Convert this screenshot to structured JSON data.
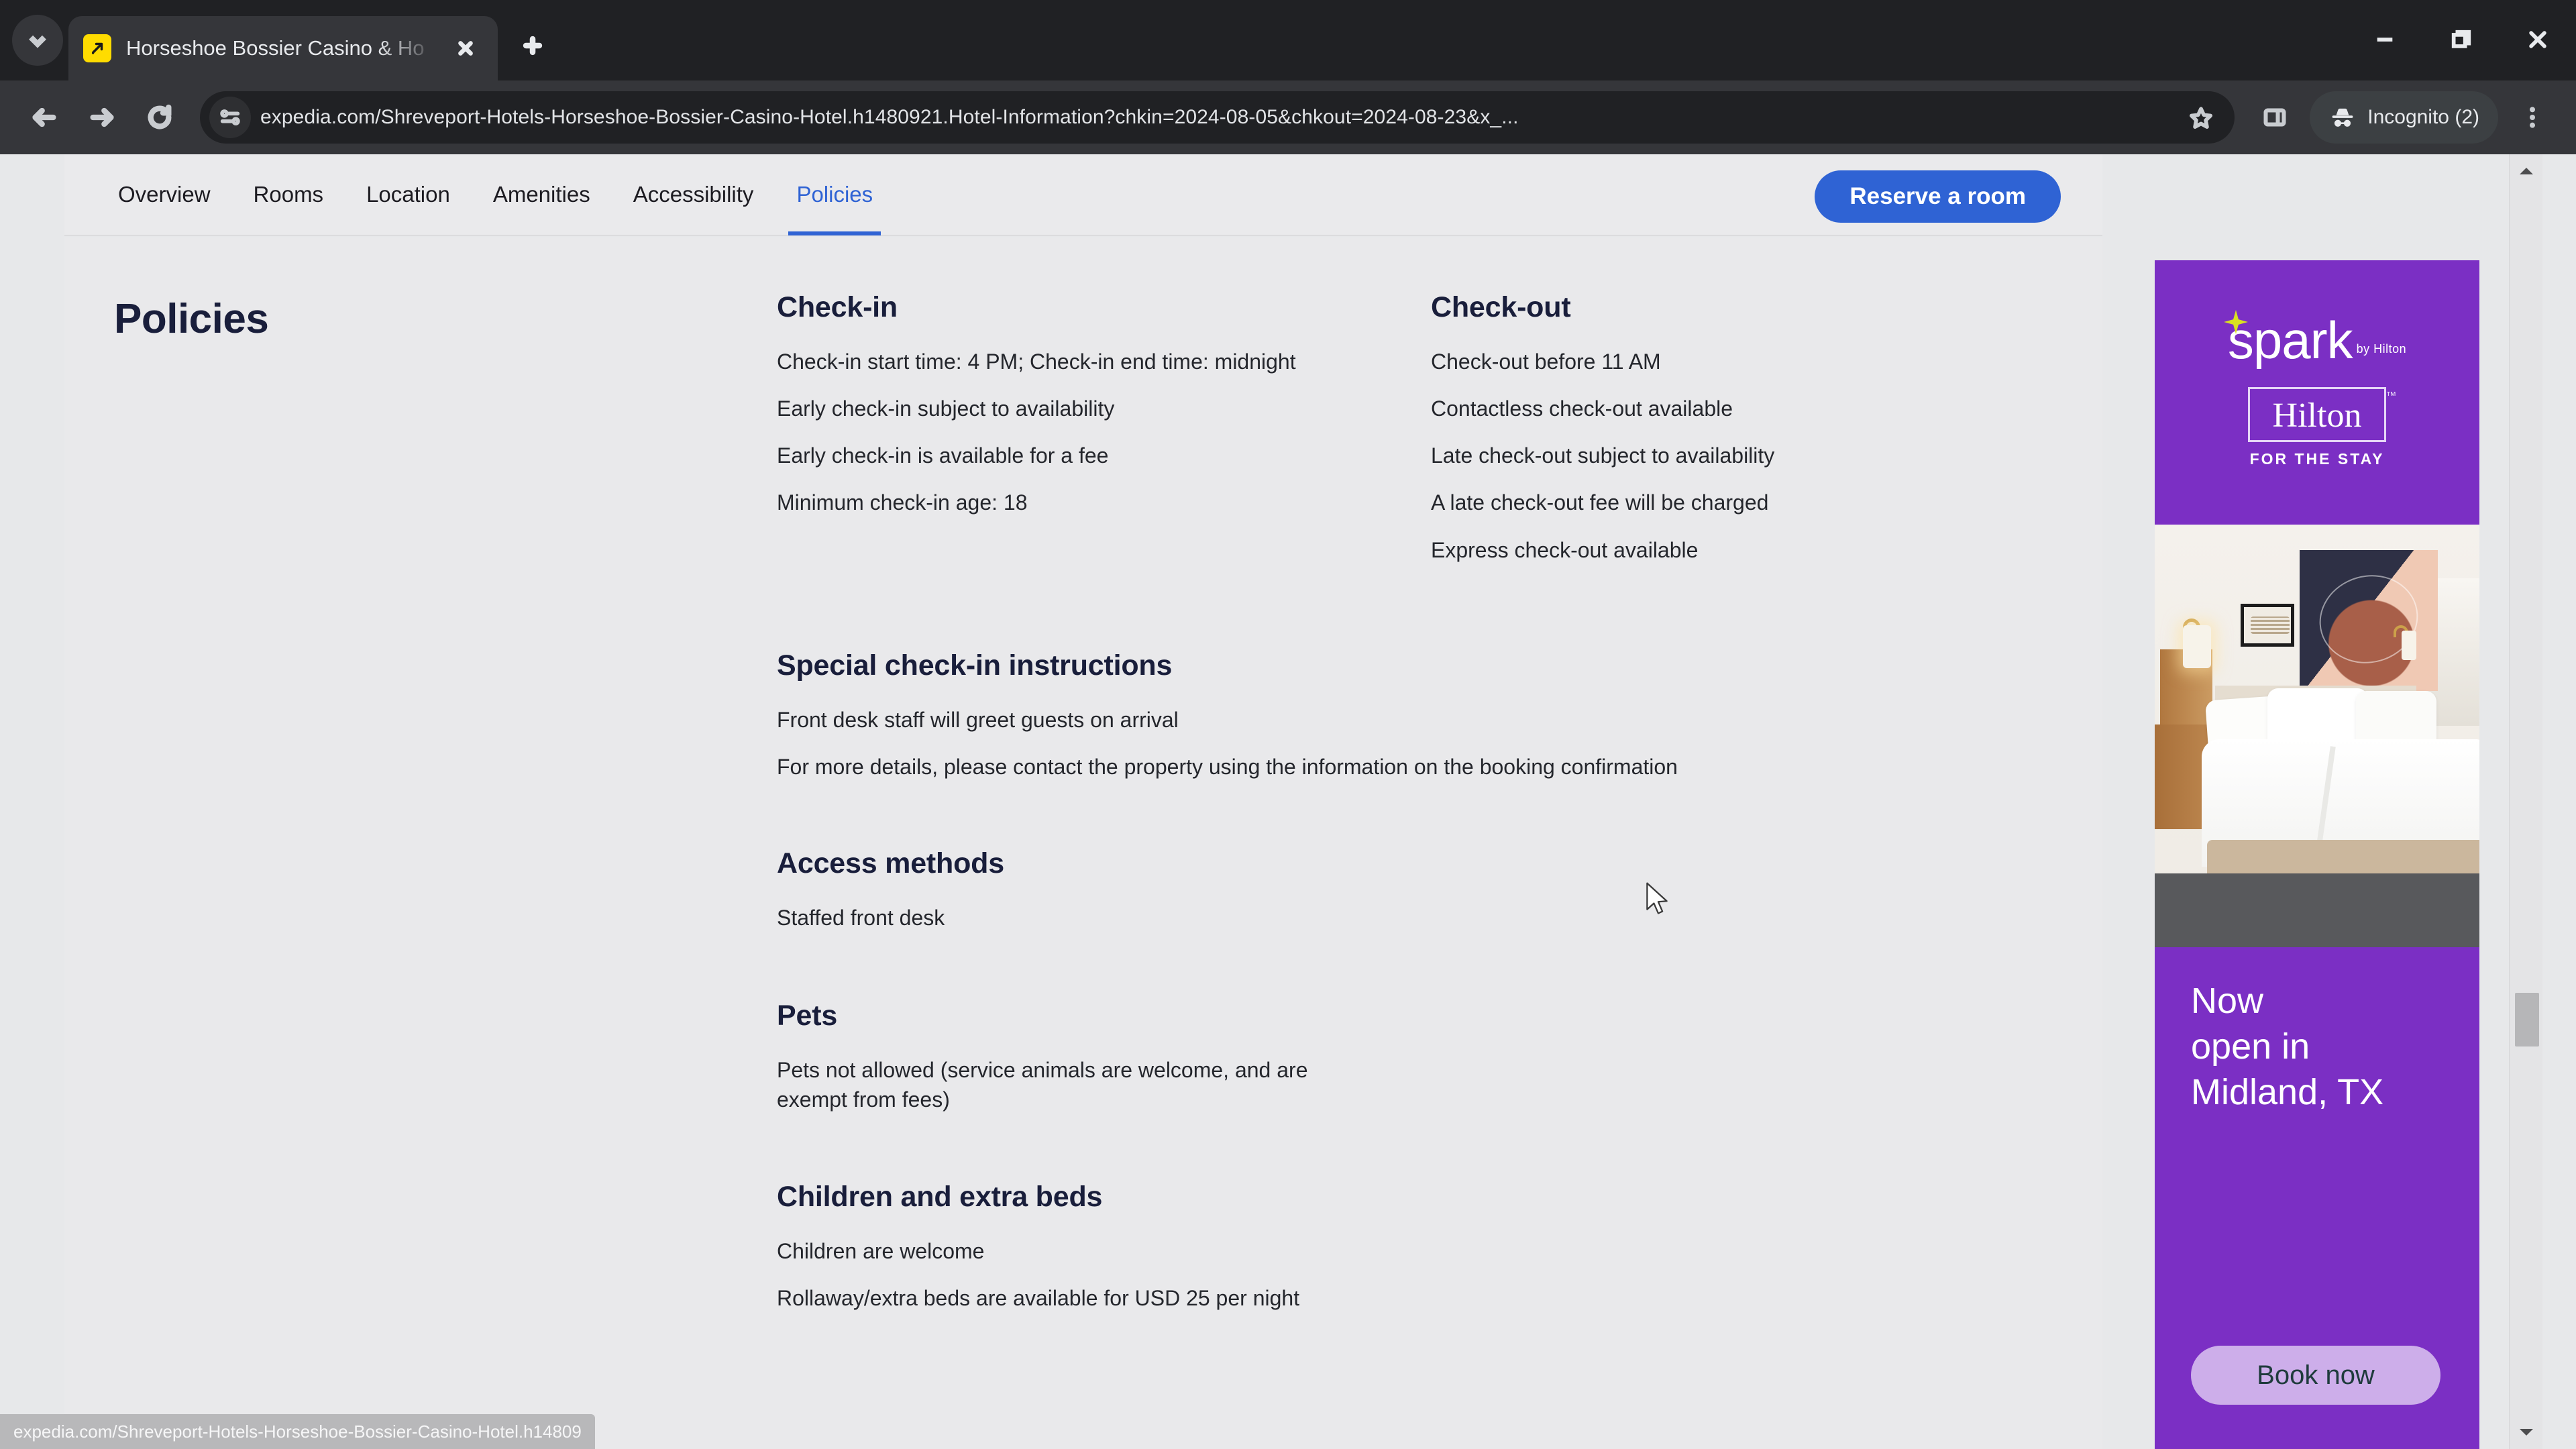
{
  "browser": {
    "tab": {
      "title": "Horseshoe Bossier Casino & Ho",
      "favicon_name": "expedia-favicon"
    },
    "new_tab_label": "+",
    "omnibox": {
      "url": "expedia.com/Shreveport-Hotels-Horseshoe-Bossier-Casino-Hotel.h1480921.Hotel-Information?chkin=2024-08-05&chkout=2024-08-23&x_...",
      "site_info_icon": "tune-icon",
      "bookmark_icon": "star-icon"
    },
    "profile": {
      "label": "Incognito (2)",
      "icon": "incognito-icon"
    },
    "window_controls": {
      "minimize": "minimize-icon",
      "restore": "restore-icon",
      "close": "close-icon"
    },
    "status_bar": {
      "text": "expedia.com/Shreveport-Hotels-Horseshoe-Bossier-Casino-Hotel.h14809"
    }
  },
  "subnav": {
    "items": [
      {
        "label": "Overview",
        "active": false
      },
      {
        "label": "Rooms",
        "active": false
      },
      {
        "label": "Location",
        "active": false
      },
      {
        "label": "Amenities",
        "active": false
      },
      {
        "label": "Accessibility",
        "active": false
      },
      {
        "label": "Policies",
        "active": true
      }
    ],
    "reserve_label": "Reserve a room",
    "accent_color": "#2f63d4"
  },
  "page": {
    "title": "Policies",
    "checkin": {
      "heading": "Check-in",
      "lines": [
        "Check-in start time: 4 PM; Check-in end time: midnight",
        "Early check-in subject to availability",
        "Early check-in is available for a fee",
        "Minimum check-in age: 18"
      ]
    },
    "checkout": {
      "heading": "Check-out",
      "lines": [
        "Check-out before 11 AM",
        "Contactless check-out available",
        "Late check-out subject to availability",
        "A late check-out fee will be charged",
        "Express check-out available"
      ]
    },
    "special_instructions": {
      "heading": "Special check-in instructions",
      "lines": [
        "Front desk staff will greet guests on arrival",
        "For more details, please contact the property using the information on the booking confirmation"
      ]
    },
    "access_methods": {
      "heading": "Access methods",
      "lines": [
        "Staffed front desk"
      ]
    },
    "pets": {
      "heading": "Pets",
      "lines": [
        "Pets not allowed (service animals are welcome, and are exempt from fees)"
      ]
    },
    "children": {
      "heading": "Children and extra beds",
      "lines": [
        "Children are welcome",
        "Rollaway/extra beds are available for USD 25 per night"
      ]
    }
  },
  "ad": {
    "brand": "spark",
    "brand_by": "by Hilton",
    "parent_brand": "Hilton",
    "tagline": "FOR THE STAY",
    "headline": "Now\nopen in\nMidland, TX",
    "headline_lines": [
      "Now",
      "open in",
      "Midland, TX"
    ],
    "cta_label": "Book now",
    "background_color": "#7b2fc4",
    "cta_color": "#cdaeea",
    "photo_alt": "hotel-room-photo"
  }
}
